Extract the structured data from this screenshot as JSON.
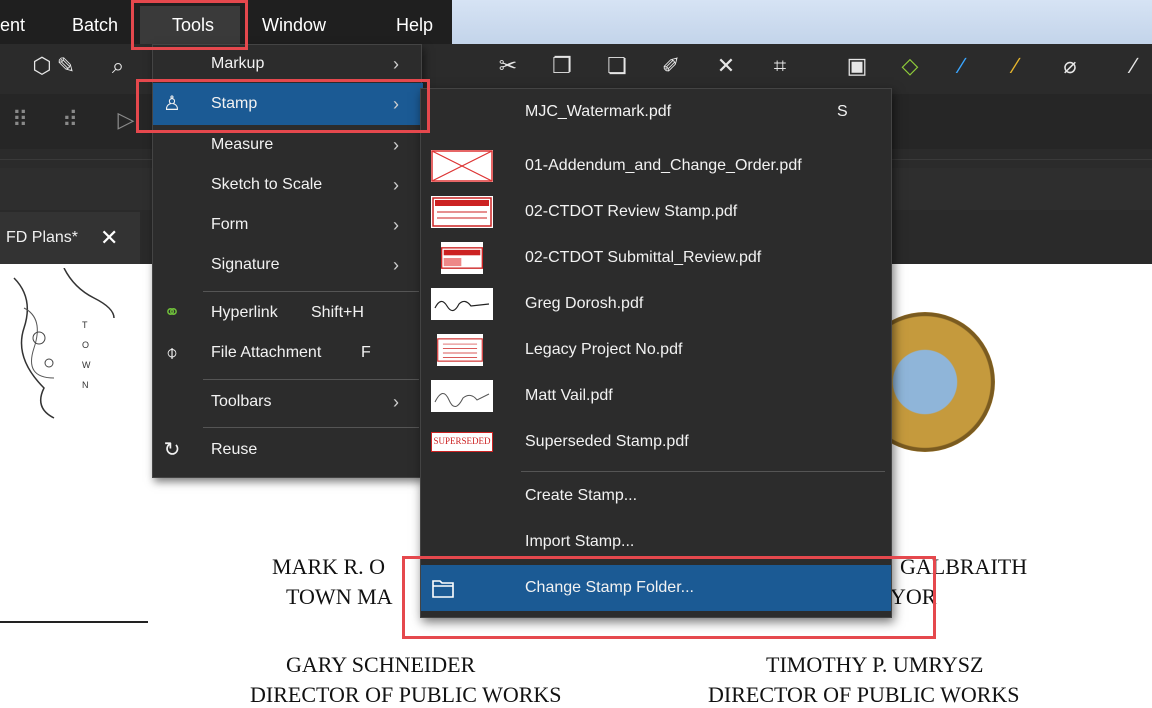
{
  "menubar": {
    "items": [
      "ent",
      "Batch",
      "Tools",
      "Window",
      "Help"
    ]
  },
  "document_tab": {
    "title": "FD Plans*",
    "close_glyph": "✕"
  },
  "tools_menu": {
    "items": [
      {
        "label": "Markup",
        "icon": "",
        "shortcut": "",
        "submenu": true
      },
      {
        "label": "Stamp",
        "icon": "stamp-icon",
        "shortcut": "",
        "submenu": true,
        "selected": true
      },
      {
        "label": "Measure",
        "icon": "",
        "shortcut": "",
        "submenu": true
      },
      {
        "label": "Sketch to Scale",
        "icon": "",
        "shortcut": "",
        "submenu": true
      },
      {
        "label": "Form",
        "icon": "",
        "shortcut": "",
        "submenu": true
      },
      {
        "label": "Signature",
        "icon": "",
        "shortcut": "",
        "submenu": true
      },
      {
        "label": "Hyperlink",
        "icon": "hyperlink-icon",
        "shortcut": "Shift+H",
        "submenu": false
      },
      {
        "label": "File Attachment",
        "icon": "paperclip-icon",
        "shortcut": "F",
        "submenu": false
      },
      {
        "label": "Toolbars",
        "icon": "",
        "shortcut": "",
        "submenu": true
      },
      {
        "label": "Reuse",
        "icon": "reuse-icon",
        "shortcut": "",
        "submenu": false
      }
    ]
  },
  "stamp_menu": {
    "items": [
      {
        "label": "MJC_Watermark.pdf",
        "shortcut": "S",
        "thumb": "none"
      },
      {
        "label": "01-Addendum_and_Change_Order.pdf",
        "shortcut": "",
        "thumb": "x-box"
      },
      {
        "label": "02-CTDOT Review Stamp.pdf",
        "shortcut": "",
        "thumb": "red-form"
      },
      {
        "label": "02-CTDOT Submittal_Review.pdf",
        "shortcut": "",
        "thumb": "red-form"
      },
      {
        "label": "Greg Dorosh.pdf",
        "shortcut": "",
        "thumb": "signature"
      },
      {
        "label": "Legacy Project No.pdf",
        "shortcut": "",
        "thumb": "red-text"
      },
      {
        "label": "Matt Vail.pdf",
        "shortcut": "",
        "thumb": "signature"
      },
      {
        "label": "Superseded Stamp.pdf",
        "shortcut": "",
        "thumb": "superseded"
      },
      {
        "label": "Create Stamp...",
        "shortcut": "",
        "thumb": "none"
      },
      {
        "label": "Import Stamp...",
        "shortcut": "",
        "thumb": "none"
      },
      {
        "label": "Change Stamp Folder...",
        "shortcut": "",
        "thumb": "folder",
        "selected": true
      }
    ],
    "superseded_thumb_text": "SUPERSEDED"
  },
  "document": {
    "line1_left": "MARK R. O",
    "line2_left": "TOWN MA",
    "line1_right": "GALBRAITH",
    "line2_right": "YOR",
    "left_name": "GARY SCHNEIDER",
    "left_title": "DIRECTOR OF PUBLIC WORKS",
    "right_name": "TIMOTHY P. UMRYSZ",
    "right_title": "DIRECTOR OF PUBLIC WORKS"
  },
  "colors": {
    "highlight": "#e5484d",
    "selection": "#1b5a94",
    "menu_bg": "#2c2c2c"
  }
}
